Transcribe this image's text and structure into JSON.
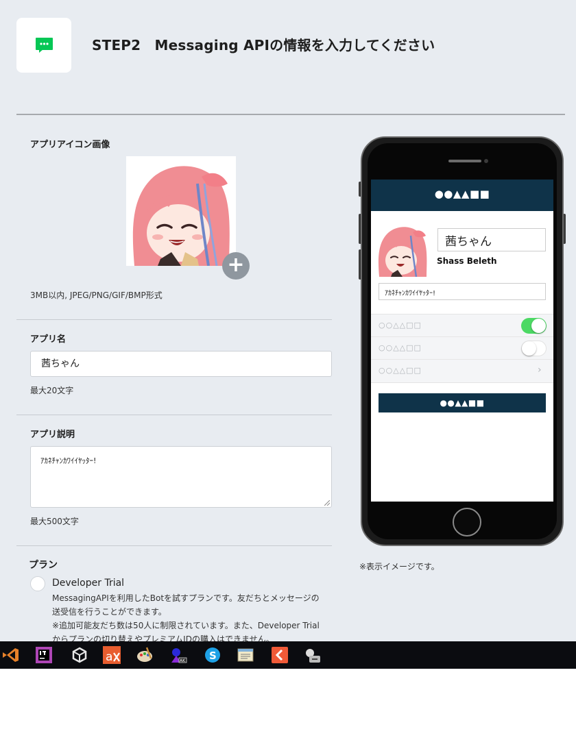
{
  "colors": {
    "background": "#e8ecf1",
    "line_green": "#06c755",
    "navy": "#0f3349",
    "toggle_on": "#4cd964",
    "taskbar": "#0b0c10"
  },
  "header": {
    "logo_icon": "line-chat-icon",
    "title": "STEP2　Messaging APIの情報を入力してください"
  },
  "form": {
    "icon_section": {
      "label": "アプリアイコン画像",
      "add_icon": "plus-icon",
      "note": "3MB以内, JPEG/PNG/GIF/BMP形式"
    },
    "app_name": {
      "label": "アプリ名",
      "value": "茜ちゃん",
      "note": "最大20文字"
    },
    "app_description": {
      "label": "アプリ説明",
      "value": "ｱｶﾈﾁｬﾝｶﾜｲｲﾔｯﾀｰ!",
      "note": "最大500文字"
    },
    "plan": {
      "label": "プラン",
      "options": [
        {
          "name": "Developer Trial",
          "description": "MessagingAPIを利用したBotを試すプランです。友だちとメッセージの送受信を行うことができます。",
          "note": "※追加可能友だち数は50人に制限されています。また、Developer Trialからプランの切り替えやプレミアムIDの購入はできません。"
        }
      ]
    }
  },
  "preview": {
    "header_title": "●●▲▲■■",
    "name": "茜ちゃん",
    "owner": "Shass Beleth",
    "description": "ｱｶﾈﾁｬﾝｶﾜｲｲﾔｯﾀｰ!",
    "settings": [
      {
        "label": "○○△△□□",
        "control": "toggle",
        "on": true
      },
      {
        "label": "○○△△□□",
        "control": "toggle",
        "on": false
      },
      {
        "label": "○○△△□□",
        "control": "chevron",
        "icon": "chevron-right-icon"
      }
    ],
    "button_label": "●●▲▲■■",
    "note": "※表示イメージです。"
  },
  "taskbar": {
    "apps": [
      "visual-studio-icon",
      "intellij-idea-icon",
      "unity-icon",
      "asana-icon",
      "paint-palette-icon",
      "character-app-icon",
      "skype-icon",
      "notepad-app-icon",
      "red-app-icon",
      "voiceroid-icon"
    ]
  }
}
